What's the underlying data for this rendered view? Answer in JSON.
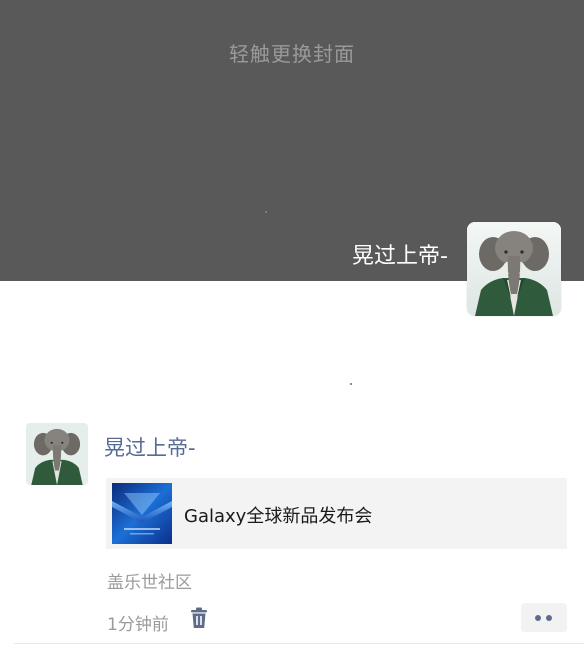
{
  "cover": {
    "hint": "轻触更换封面",
    "background_color": "#595959"
  },
  "profile": {
    "name": "晃过上帝-",
    "avatar_icon": "elephant-avatar"
  },
  "post": {
    "author": "晃过上帝-",
    "author_color": "#576b95",
    "card": {
      "thumbnail_icon": "galaxy-event-thumbnail",
      "title": "Galaxy全球新品发布会"
    },
    "source": "盖乐世社区",
    "time": "1分钟前",
    "delete_icon": "trash-icon",
    "more_icon": "more-dots-icon"
  }
}
